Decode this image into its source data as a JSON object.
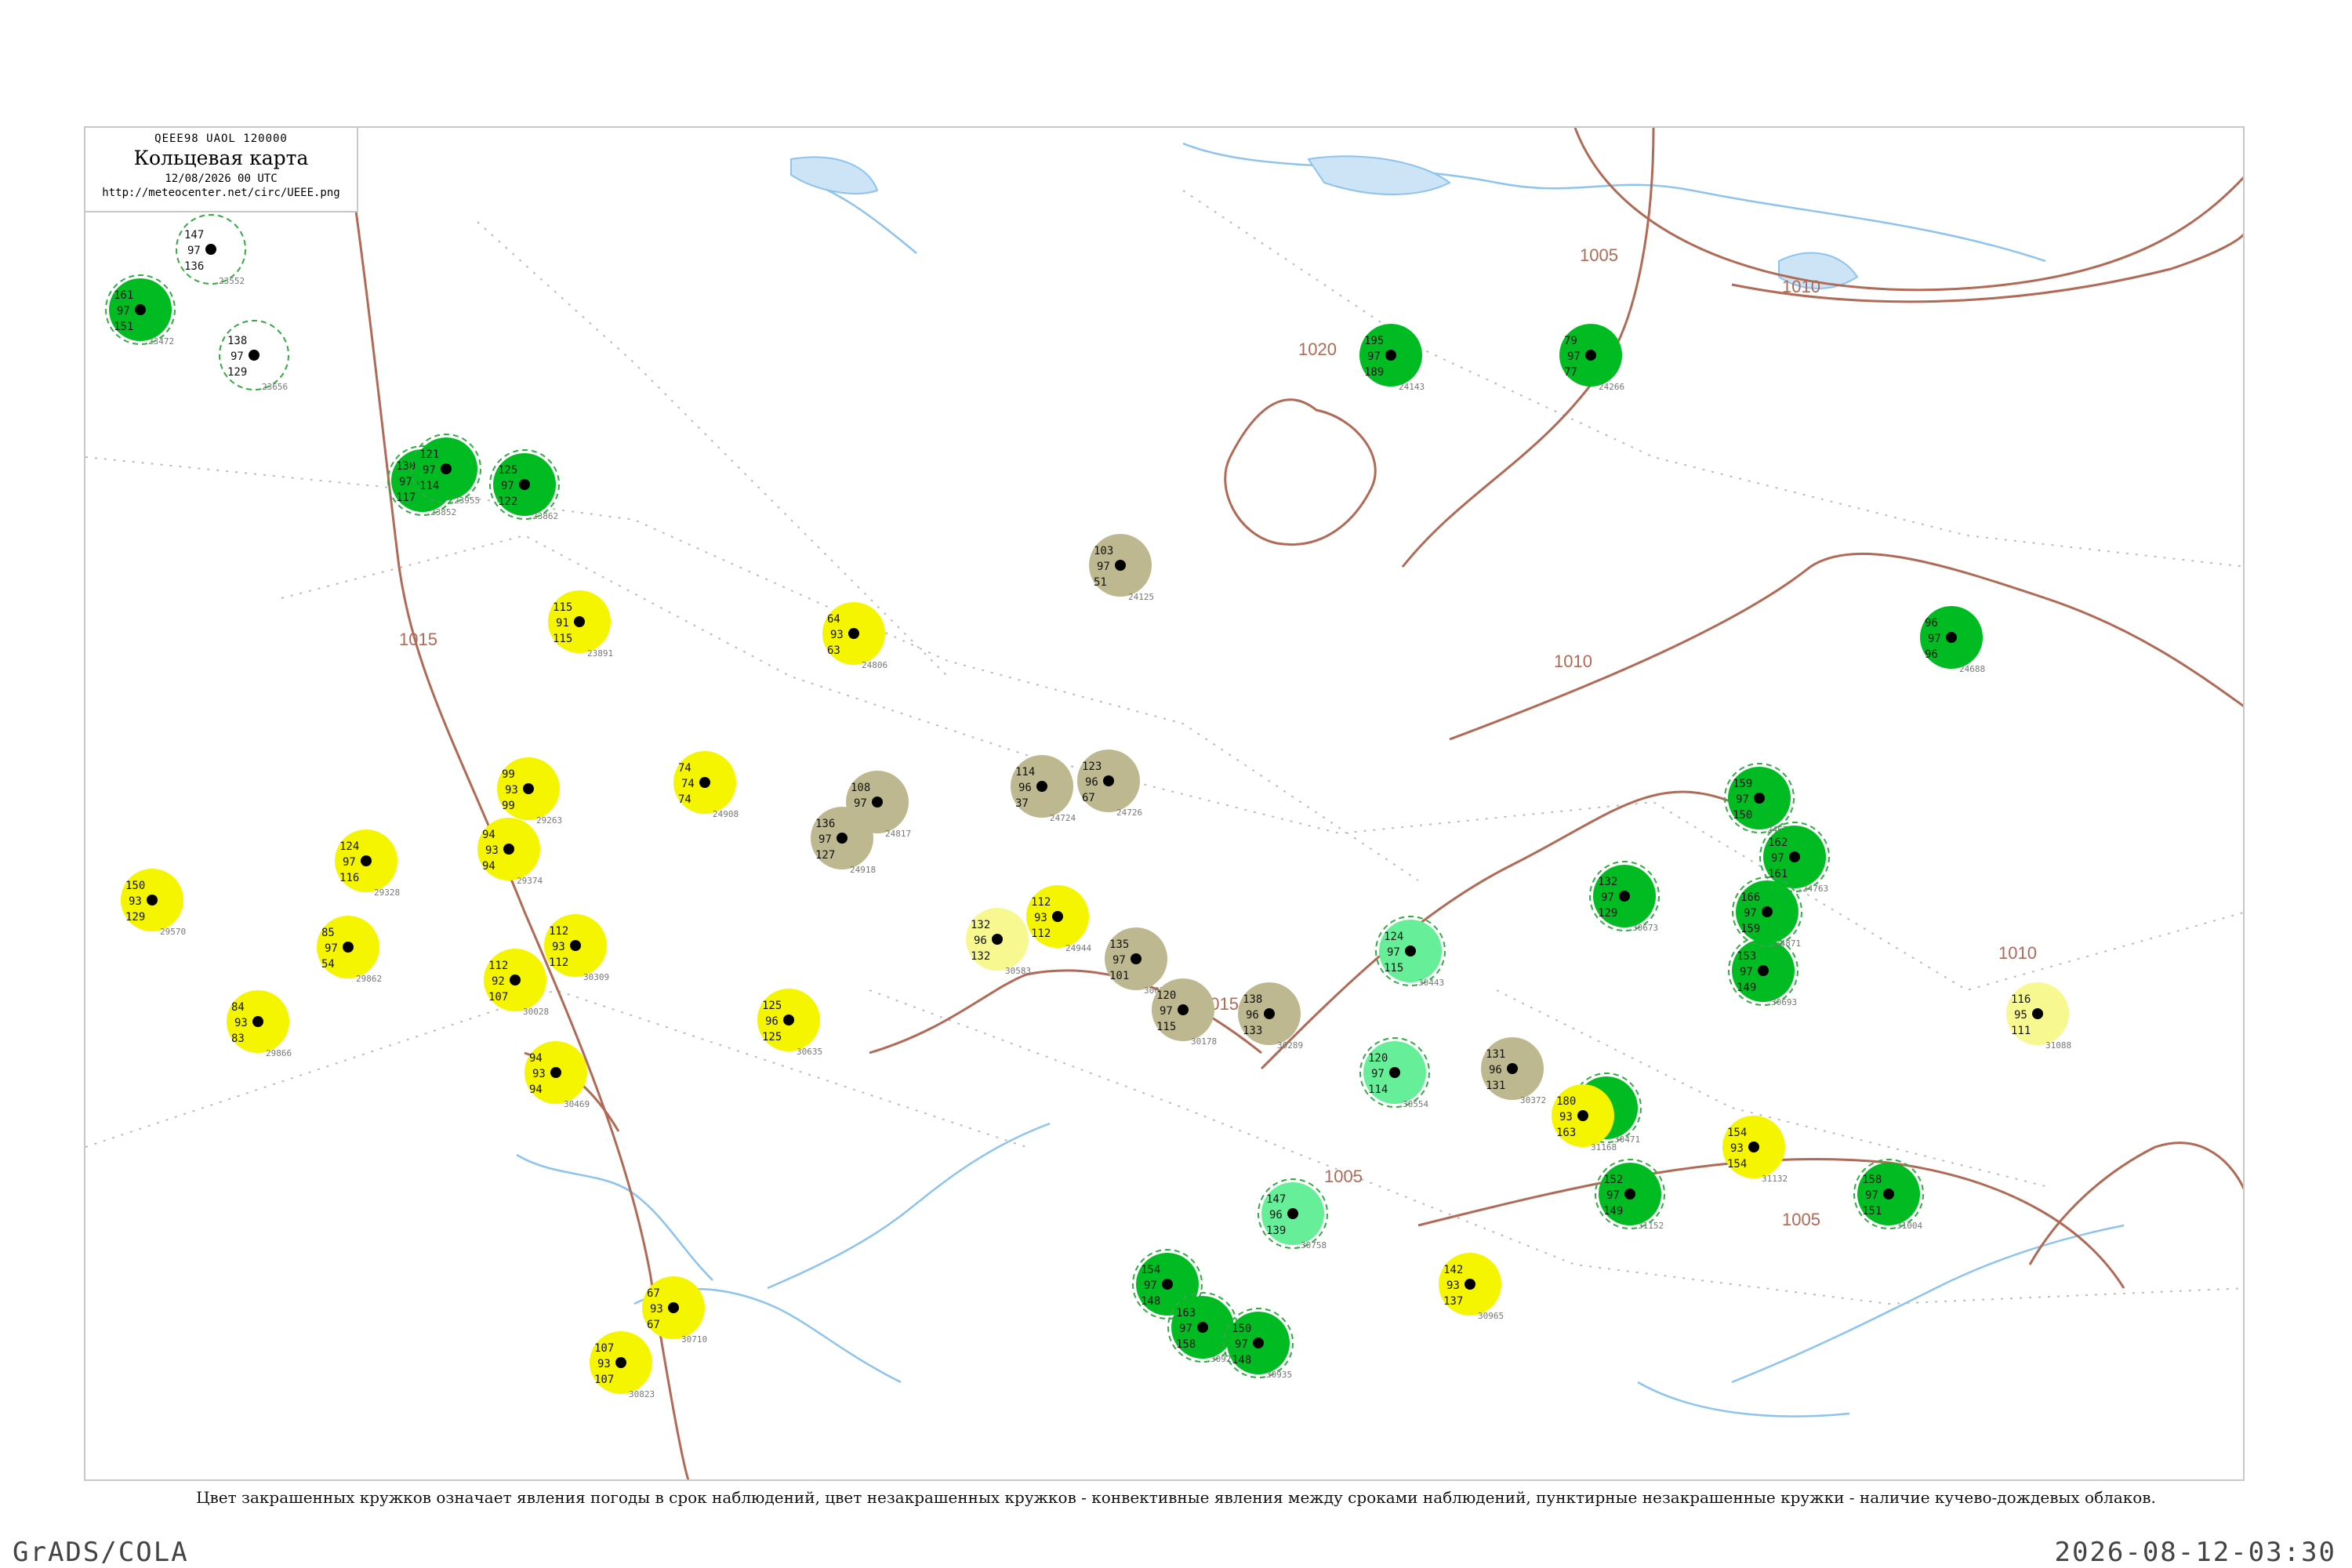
{
  "header": {
    "code": "QEEE98  UAOL  120000",
    "title": "Кольцевая карта",
    "datetime": "12/08/2026 00 UTC",
    "url": "http://meteocenter.net/circ/UEEE.png"
  },
  "caption": "Цвет закрашенных кружков означает явления погоды в срок наблюдений, цвет незакрашенных кружков - конвективные явления между сроками наблюдений, пунктирные незакрашенные кружки - наличие кучево-дождевых облаков.",
  "footer": {
    "left": "GrADS/COLA",
    "right": "2026-08-12-03:30"
  },
  "colors": {
    "rain_green": "#00bb22",
    "shower_green": "#66ee99",
    "drizzle_yellow": "#f5f500",
    "pale_yellow": "#f8f890",
    "fog_olive": "#bdb890",
    "cb_dashed": "#33aa44",
    "river_blue": "#8cc4ee",
    "isobar_brown": "#b06a55",
    "border_dotted": "#bbbbbb"
  },
  "isobars": [
    {
      "label": "1005"
    },
    {
      "label": "1010"
    },
    {
      "label": "1015"
    },
    {
      "label": "1020"
    }
  ],
  "stations": [
    {
      "id": "23472",
      "fill": "rain_green",
      "cb": true,
      "p": "161",
      "t": "97",
      "td": "151"
    },
    {
      "id": "23552",
      "fill": "none",
      "cb": true,
      "p": "147",
      "t": "97",
      "td": "136"
    },
    {
      "id": "23656",
      "fill": "none",
      "cb": true,
      "p": "138",
      "t": "97",
      "td": "129"
    },
    {
      "id": "23852",
      "fill": "rain_green",
      "cb": true,
      "p": "130",
      "t": "97",
      "td": "117"
    },
    {
      "id": "23862",
      "fill": "rain_green",
      "cb": true,
      "p": "125",
      "t": "97",
      "td": "122"
    },
    {
      "id": "23955",
      "fill": "rain_green",
      "cb": true,
      "p": "121",
      "t": "97",
      "td": "114"
    },
    {
      "id": "24908",
      "fill": "drizzle_yellow",
      "cb": false,
      "p": "74",
      "t": "74",
      "td": "74"
    },
    {
      "id": "24806",
      "fill": "drizzle_yellow",
      "cb": false,
      "p": "64",
      "t": "93",
      "td": "63"
    },
    {
      "id": "23891",
      "fill": "drizzle_yellow",
      "cb": false,
      "p": "115",
      "t": "91",
      "td": "115"
    },
    {
      "id": "24125",
      "fill": "fog_olive",
      "cb": false,
      "p": "103",
      "t": "97",
      "td": "51"
    },
    {
      "id": "24817",
      "fill": "fog_olive",
      "cb": false,
      "p": "108",
      "t": "97",
      "td": "96"
    },
    {
      "id": "24724",
      "fill": "fog_olive",
      "cb": false,
      "p": "114",
      "t": "96",
      "td": "37"
    },
    {
      "id": "24726",
      "fill": "fog_olive",
      "cb": false,
      "p": "123",
      "t": "96",
      "td": "67"
    },
    {
      "id": "24918",
      "fill": "fog_olive",
      "cb": false,
      "p": "136",
      "t": "97",
      "td": "127"
    },
    {
      "id": "29263",
      "fill": "drizzle_yellow",
      "cb": false,
      "p": "99",
      "t": "93",
      "td": "99"
    },
    {
      "id": "29374",
      "fill": "drizzle_yellow",
      "cb": false,
      "p": "94",
      "t": "93",
      "td": "94"
    },
    {
      "id": "29328",
      "fill": "drizzle_yellow",
      "cb": false,
      "p": "124",
      "t": "97",
      "td": "116"
    },
    {
      "id": "29570",
      "fill": "drizzle_yellow",
      "cb": false,
      "p": "150",
      "t": "93",
      "td": "129"
    },
    {
      "id": "30309",
      "fill": "drizzle_yellow",
      "cb": false,
      "p": "112",
      "t": "93",
      "td": "112"
    },
    {
      "id": "30028",
      "fill": "drizzle_yellow",
      "cb": false,
      "p": "112",
      "t": "92",
      "td": "107"
    },
    {
      "id": "24944",
      "fill": "drizzle_yellow",
      "cb": false,
      "p": "112",
      "t": "93",
      "td": "112"
    },
    {
      "id": "24143",
      "fill": "rain_green",
      "cb": false,
      "p": "195",
      "t": "97",
      "td": "189"
    },
    {
      "id": "24266",
      "fill": "rain_green",
      "cb": false,
      "p": "79",
      "t": "97",
      "td": "77"
    },
    {
      "id": "24688",
      "fill": "rain_green",
      "cb": false,
      "p": "96",
      "t": "97",
      "td": "96"
    },
    {
      "id": "30074",
      "fill": "fog_olive",
      "cb": false,
      "p": "135",
      "t": "97",
      "td": "101"
    },
    {
      "id": "30178",
      "fill": "fog_olive",
      "cb": false,
      "p": "120",
      "t": "97",
      "td": "115"
    },
    {
      "id": "30289",
      "fill": "fog_olive",
      "cb": false,
      "p": "138",
      "t": "96",
      "td": "133"
    },
    {
      "id": "30372",
      "fill": "fog_olive",
      "cb": false,
      "p": "131",
      "t": "96",
      "td": "131"
    },
    {
      "id": "30443",
      "fill": "shower_green",
      "cb": true,
      "p": "124",
      "t": "97",
      "td": "115"
    },
    {
      "id": "30554",
      "fill": "shower_green",
      "cb": true,
      "p": "120",
      "t": "97",
      "td": "114"
    },
    {
      "id": "30471",
      "fill": "rain_green",
      "cb": true,
      "p": "172",
      "t": "97",
      "td": "168"
    },
    {
      "id": "30673",
      "fill": "rain_green",
      "cb": true,
      "p": "132",
      "t": "97",
      "td": "129"
    },
    {
      "id": "30693",
      "fill": "rain_green",
      "cb": true,
      "p": "153",
      "t": "97",
      "td": "149"
    },
    {
      "id": "30758",
      "fill": "shower_green",
      "cb": true,
      "p": "147",
      "t": "96",
      "td": "139"
    },
    {
      "id": "30823",
      "fill": "rain_green",
      "cb": true,
      "p": "154",
      "t": "97",
      "td": "148"
    },
    {
      "id": "30925",
      "fill": "rain_green",
      "cb": true,
      "p": "163",
      "t": "97",
      "td": "158"
    },
    {
      "id": "30935",
      "fill": "rain_green",
      "cb": true,
      "p": "150",
      "t": "97",
      "td": "148"
    },
    {
      "id": "24671",
      "fill": "rain_green",
      "cb": true,
      "p": "159",
      "t": "97",
      "td": "150"
    },
    {
      "id": "24763",
      "fill": "rain_green",
      "cb": true,
      "p": "162",
      "t": "97",
      "td": "161"
    },
    {
      "id": "24871",
      "fill": "rain_green",
      "cb": true,
      "p": "166",
      "t": "97",
      "td": "159"
    },
    {
      "id": "31004",
      "fill": "rain_green",
      "cb": true,
      "p": "158",
      "t": "97",
      "td": "151"
    },
    {
      "id": "31152",
      "fill": "rain_green",
      "cb": true,
      "p": "152",
      "t": "97",
      "td": "149"
    },
    {
      "id": "31132",
      "fill": "drizzle_yellow",
      "cb": false,
      "p": "154",
      "t": "93",
      "td": "154"
    },
    {
      "id": "31088",
      "fill": "pale_yellow",
      "cb": false,
      "p": "116",
      "t": "95",
      "td": "111"
    },
    {
      "id": "31168",
      "fill": "drizzle_yellow",
      "cb": false,
      "p": "180",
      "t": "93",
      "td": "163"
    },
    {
      "id": "30965",
      "fill": "drizzle_yellow",
      "cb": false,
      "p": "142",
      "t": "93",
      "td": "137"
    },
    {
      "id": "30823b",
      "fill": "drizzle_yellow",
      "cb": false,
      "p": "107",
      "t": "93",
      "td": "107"
    },
    {
      "id": "30710",
      "fill": "drizzle_yellow",
      "cb": false,
      "p": "67",
      "t": "93",
      "td": "67"
    },
    {
      "id": "30635",
      "fill": "drizzle_yellow",
      "cb": false,
      "p": "125",
      "t": "96",
      "td": "125"
    },
    {
      "id": "30469",
      "fill": "drizzle_yellow",
      "cb": false,
      "p": "94",
      "t": "93",
      "td": "94"
    },
    {
      "id": "30583",
      "fill": "pale_yellow",
      "cb": false,
      "p": "132",
      "t": "96",
      "td": "132"
    },
    {
      "id": "29866",
      "fill": "drizzle_yellow",
      "cb": false,
      "p": "84",
      "t": "93",
      "td": "83"
    },
    {
      "id": "29862",
      "fill": "drizzle_yellow",
      "cb": false,
      "p": "85",
      "t": "97",
      "td": "54"
    }
  ]
}
